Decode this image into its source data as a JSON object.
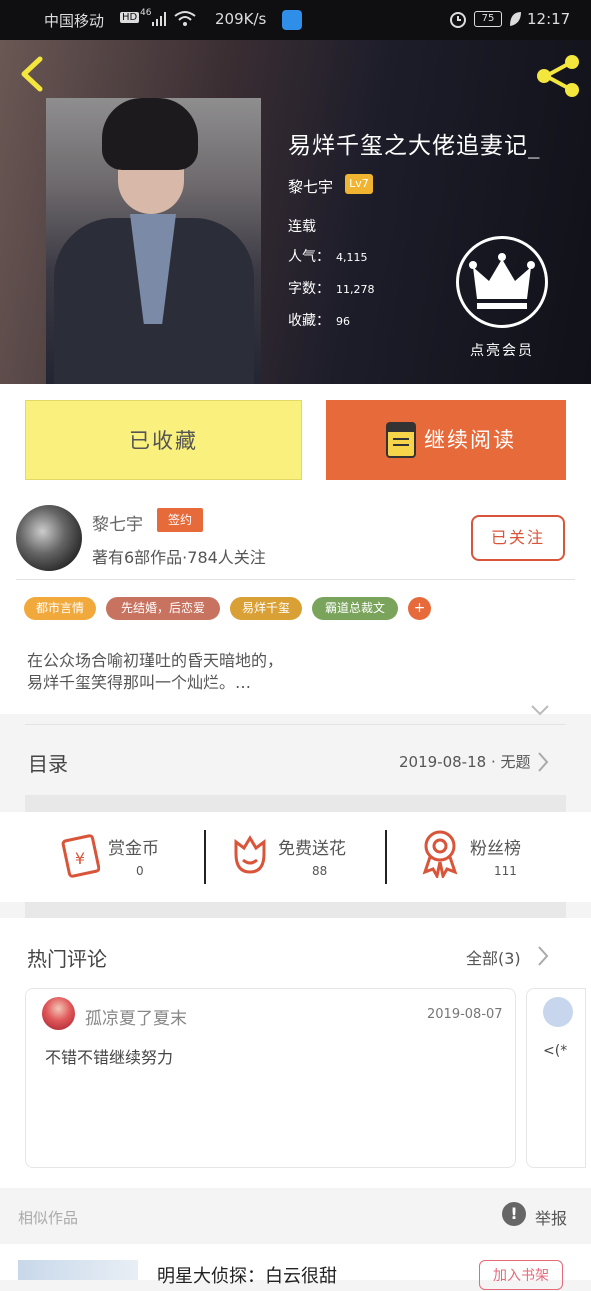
{
  "status_bar": {
    "carrier": "中国移动",
    "hd": "HD",
    "network": "46",
    "speed": "209K/s",
    "battery": "75",
    "time": "12:17"
  },
  "book": {
    "title": "易烊千玺之大佬追妻记_",
    "author": "黎七宇",
    "level": "Lv7",
    "status": "连载",
    "popularity_label": "人气：",
    "popularity": "4,115",
    "words_label": "字数：",
    "words": "11,278",
    "favorites_label": "收藏：",
    "favorites": "96",
    "vip_label": "点亮会员"
  },
  "actions": {
    "favorited": "已收藏",
    "continue_reading": "继续阅读"
  },
  "author_panel": {
    "name": "黎七宇",
    "signed_badge": "签约",
    "stats": "著有6部作品·784人关注",
    "follow_label": "已关注"
  },
  "tags": [
    {
      "label": "都市言情",
      "color": "#f2a93b"
    },
    {
      "label": "先结婚，后恋爱",
      "color": "#c8735f"
    },
    {
      "label": "易烊千玺",
      "color": "#d9a035"
    },
    {
      "label": "霸道总裁文",
      "color": "#7aa35c"
    }
  ],
  "tag_add": "+",
  "description": {
    "line1": "在公众场合喻初瑾吐的昏天暗地的，",
    "line2": "易烊千玺笑得那叫一个灿烂。…"
  },
  "toc": {
    "label": "目录",
    "latest": "2019-08-18 · 无题"
  },
  "rewards": [
    {
      "label": "赏金币",
      "value": "0",
      "icon": "red-envelope-icon"
    },
    {
      "label": "免费送花",
      "value": "88",
      "icon": "flower-icon"
    },
    {
      "label": "粉丝榜",
      "value": "111",
      "icon": "medal-icon"
    }
  ],
  "comments": {
    "title": "热门评论",
    "all_label": "全部(3)",
    "items": [
      {
        "user": "孤凉夏了夏末",
        "date": "2019-08-07",
        "text": "不错不错继续努力"
      }
    ],
    "next_preview": "<(*"
  },
  "similar": {
    "label": "相似作品",
    "report": "举报",
    "next_title": "明星大侦探：白云很甜",
    "add_shelf": "加入书架"
  },
  "colors": {
    "accent_orange": "#e76a3b",
    "fav_yellow": "#f9f07d",
    "crown_white": "#ffffff"
  }
}
